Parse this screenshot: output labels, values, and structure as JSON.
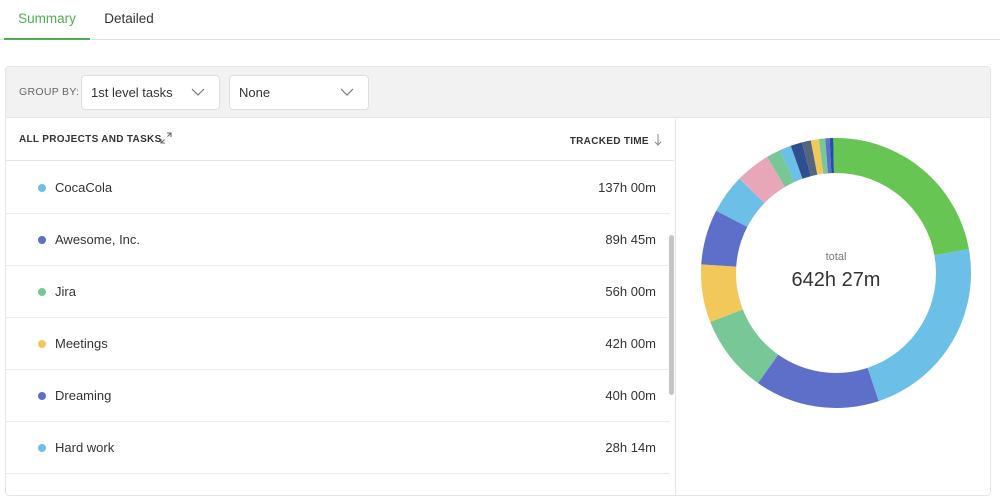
{
  "tabs": [
    {
      "label": "Summary",
      "active": true
    },
    {
      "label": "Detailed",
      "active": false
    }
  ],
  "filters": {
    "group_by_label": "GROUP BY:",
    "group_by_value": "1st level tasks",
    "second_group_value": "None"
  },
  "table": {
    "col_projects": "ALL PROJECTS AND TASKS",
    "col_time": "TRACKED TIME",
    "rows": [
      {
        "name": "CocaCola",
        "time": "137h 00m",
        "color": "#6cbfe6"
      },
      {
        "name": "Awesome, Inc.",
        "time": "89h 45m",
        "color": "#5d6fc9"
      },
      {
        "name": "Jira",
        "time": "56h 00m",
        "color": "#78c796"
      },
      {
        "name": "Meetings",
        "time": "42h 00m",
        "color": "#f2c85b"
      },
      {
        "name": "Dreaming",
        "time": "40h 00m",
        "color": "#5d6fc9"
      },
      {
        "name": "Hard work",
        "time": "28h 14m",
        "color": "#6cbfe6"
      }
    ]
  },
  "chart": {
    "total_label": "total",
    "total_value": "642h 27m"
  },
  "chart_data": {
    "type": "pie",
    "title": "",
    "note": "donut chart; slices proportional to tracked time",
    "slices": [
      {
        "value": 20.8,
        "color": "#67c554"
      },
      {
        "value": 21.3,
        "color": "#6cbfe6"
      },
      {
        "value": 14.0,
        "color": "#5d6fc9"
      },
      {
        "value": 8.7,
        "color": "#78c796"
      },
      {
        "value": 6.5,
        "color": "#f2c85b"
      },
      {
        "value": 6.2,
        "color": "#5d6fc9"
      },
      {
        "value": 4.4,
        "color": "#6cbfe6"
      },
      {
        "value": 3.9,
        "color": "#e8a7b8"
      },
      {
        "value": 1.6,
        "color": "#78c796"
      },
      {
        "value": 1.3,
        "color": "#6cbfe6"
      },
      {
        "value": 1.3,
        "color": "#2f4e8f"
      },
      {
        "value": 1.0,
        "color": "#56657f"
      },
      {
        "value": 0.9,
        "color": "#f2c85b"
      },
      {
        "value": 0.7,
        "color": "#78c796"
      },
      {
        "value": 0.5,
        "color": "#5d6fc9"
      },
      {
        "value": 0.4,
        "color": "#1f4fa8"
      },
      {
        "value": 0.3,
        "color": "#67c554"
      }
    ]
  }
}
